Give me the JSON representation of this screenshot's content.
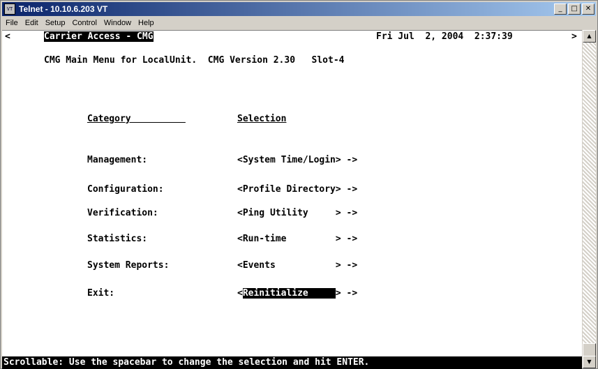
{
  "window": {
    "title": "Telnet - 10.10.6.203 VT",
    "icon": "telnet-app-icon",
    "icon_text": "VT"
  },
  "controls": {
    "minimize": "_",
    "maximize": "□",
    "close": "✕"
  },
  "menu": [
    "File",
    "Edit",
    "Setup",
    "Control",
    "Window",
    "Help"
  ],
  "terminal": {
    "left_marker": "<",
    "right_marker": ">",
    "header_title": "Carrier Access - CMG",
    "datetime": "Fri Jul  2, 2004  2:37:39",
    "main_menu_line": "CMG Main Menu for LocalUnit.  CMG Version 2.30   Slot-4",
    "col_category": "Category          ",
    "col_selection": "Selection",
    "rows": [
      {
        "label": "Management:",
        "sel_open": "<",
        "selection": "System Time/Login",
        "sel_close": "> ->"
      },
      {
        "label": "Configuration:",
        "sel_open": "<",
        "selection": "Profile Directory",
        "sel_close": "> ->"
      },
      {
        "label": "Verification:",
        "sel_open": "<",
        "selection": "Ping Utility     ",
        "sel_close": "> ->"
      },
      {
        "label": "Statistics:",
        "sel_open": "<",
        "selection": "Run-time         ",
        "sel_close": "> ->"
      },
      {
        "label": "System Reports:",
        "sel_open": "<",
        "selection": "Events           ",
        "sel_close": "> ->"
      },
      {
        "label": "Exit:",
        "sel_open": "<",
        "selection": "Reinitialize     ",
        "sel_close": "> ->"
      }
    ],
    "status": "Scrollable: Use the spacebar to change the selection and hit ENTER."
  },
  "scrollbar": {
    "up": "▲",
    "down": "▼"
  }
}
